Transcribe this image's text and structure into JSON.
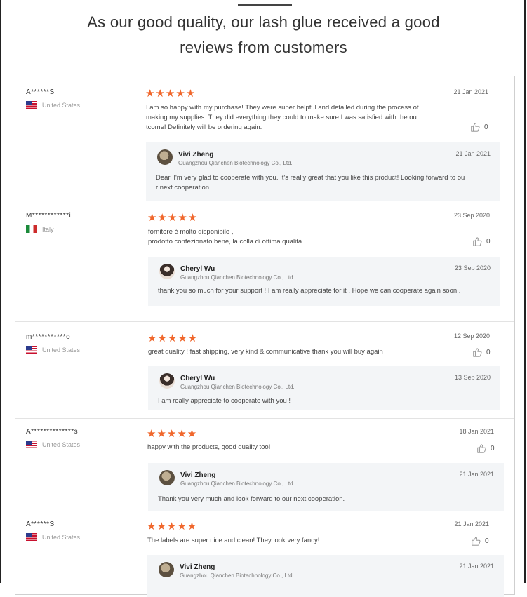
{
  "header": {
    "line1": "As our good quality, our lash glue received a good",
    "line2": "reviews from customers"
  },
  "colors": {
    "star": "#f0672c",
    "reply_bg": "#f3f5f7",
    "border": "#cfcfcf"
  },
  "reviews": [
    {
      "name": "A******S",
      "country": "United States",
      "flag": "us-flag-icon",
      "rating": 5,
      "stars": "★★★★★",
      "date": "21 Jan 2021",
      "text_lines": [
        "I am so happy with my purchase! They were super helpful and detailed during the process of",
        "making my supplies. They did everything they could to make sure I was satisfied with the ou",
        "tcome! Definitely will be ordering again."
      ],
      "likes": "0",
      "reply": {
        "name": "Vivi Zheng",
        "company": "Guangzhou Qianchen Biotechnology Co., Ltd.",
        "date": "21 Jan 2021",
        "text_lines": [
          "Dear, I'm very glad to cooperate with you. It's really great that you like this product! Looking forward to ou",
          "r next cooperation."
        ]
      }
    },
    {
      "name": "M************i",
      "country": "Italy",
      "flag": "italy-flag-icon",
      "rating": 5,
      "stars": "★★★★★",
      "date": "23 Sep 2020",
      "text_lines": [
        "fornitore    è molto disponibile ,",
        "prodotto confezionato bene, la colla di ottima qualità."
      ],
      "likes": "0",
      "reply": {
        "name": "Cheryl Wu",
        "company": "Guangzhou Qianchen Biotechnology Co., Ltd.",
        "date": "23 Sep 2020",
        "text_lines": [
          "thank you so much for your support ! I am really appreciate for it . Hope we can cooperate again soon ."
        ]
      }
    },
    {
      "name": "m***********o",
      "country": "United States",
      "flag": "us-flag-icon",
      "rating": 5,
      "stars": "★★★★★",
      "date": "12 Sep 2020",
      "text_lines": [
        "great quality ! fast shipping, very kind & communicative  thank you will buy again"
      ],
      "likes": "0",
      "reply": {
        "name": "Cheryl Wu",
        "company": "Guangzhou Qianchen Biotechnology Co., Ltd.",
        "date": "13 Sep 2020",
        "text_lines": [
          "I am really appreciate to cooperate with you !"
        ]
      }
    },
    {
      "name": "A**************s",
      "country": "United States",
      "flag": "us-flag-icon",
      "rating": 5,
      "stars": "★★★★★",
      "date": "18 Jan 2021",
      "text_lines": [
        "happy with the products, good quality too!"
      ],
      "likes": "0",
      "reply": {
        "name": "Vivi Zheng",
        "company": "Guangzhou Qianchen Biotechnology Co., Ltd.",
        "date": "21 Jan 2021",
        "text_lines": [
          "Thank you very much and look forward to our next cooperation."
        ]
      }
    },
    {
      "name": "A******S",
      "country": "United States",
      "flag": "us-flag-icon",
      "rating": 5,
      "stars": "★★★★★",
      "date": "21 Jan 2021",
      "text_lines": [
        "The labels are super nice and clean! They look very fancy!"
      ],
      "likes": "0",
      "reply": {
        "name": "Vivi Zheng",
        "company": "Guangzhou Qianchen Biotechnology Co., Ltd.",
        "date": "21 Jan 2021",
        "text_lines": []
      }
    }
  ]
}
